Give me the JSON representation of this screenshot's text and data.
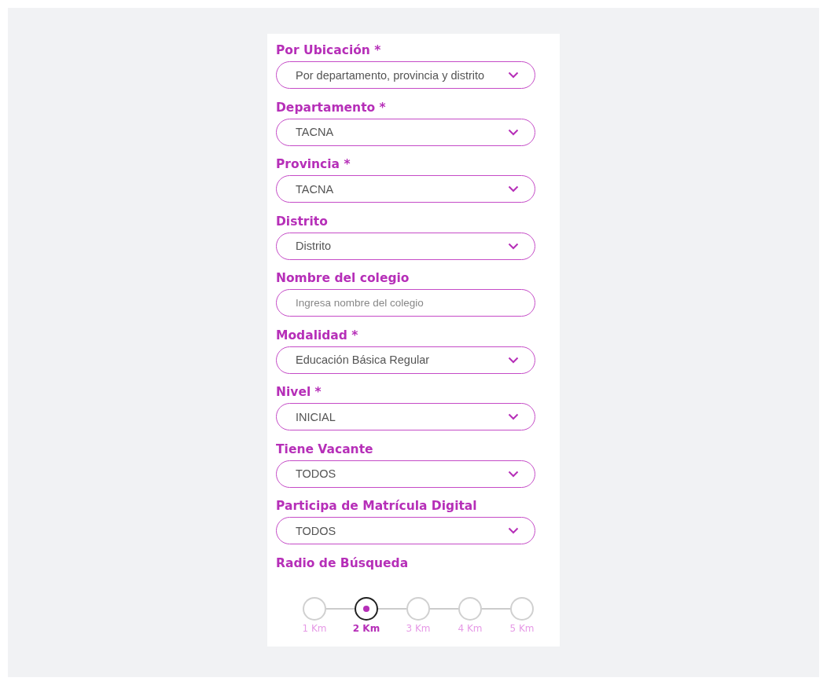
{
  "fields": [
    {
      "label": "Por Ubicación *",
      "kind": "select",
      "value": "Por departamento, provincia y distrito"
    },
    {
      "label": "Departamento *",
      "kind": "select",
      "value": "TACNA"
    },
    {
      "label": "Provincia *",
      "kind": "select",
      "value": "TACNA"
    },
    {
      "label": "Distrito",
      "kind": "select",
      "value": "Distrito"
    },
    {
      "label": "Nombre del colegio",
      "kind": "text",
      "placeholder": "Ingresa nombre del colegio"
    },
    {
      "label": "Modalidad *",
      "kind": "select",
      "value": "Educación Básica Regular"
    },
    {
      "label": "Nivel *",
      "kind": "select",
      "value": "INICIAL"
    },
    {
      "label": "Tiene Vacante",
      "kind": "select",
      "value": "TODOS"
    },
    {
      "label": "Participa de Matrícula Digital",
      "kind": "select",
      "value": "TODOS"
    }
  ],
  "radius": {
    "label": "Radio de Búsqueda",
    "options": [
      {
        "label": "1 Km",
        "selected": false
      },
      {
        "label": "2 Km",
        "selected": true
      },
      {
        "label": "3 Km",
        "selected": false
      },
      {
        "label": "4 Km",
        "selected": false
      },
      {
        "label": "5 Km",
        "selected": false
      }
    ]
  }
}
